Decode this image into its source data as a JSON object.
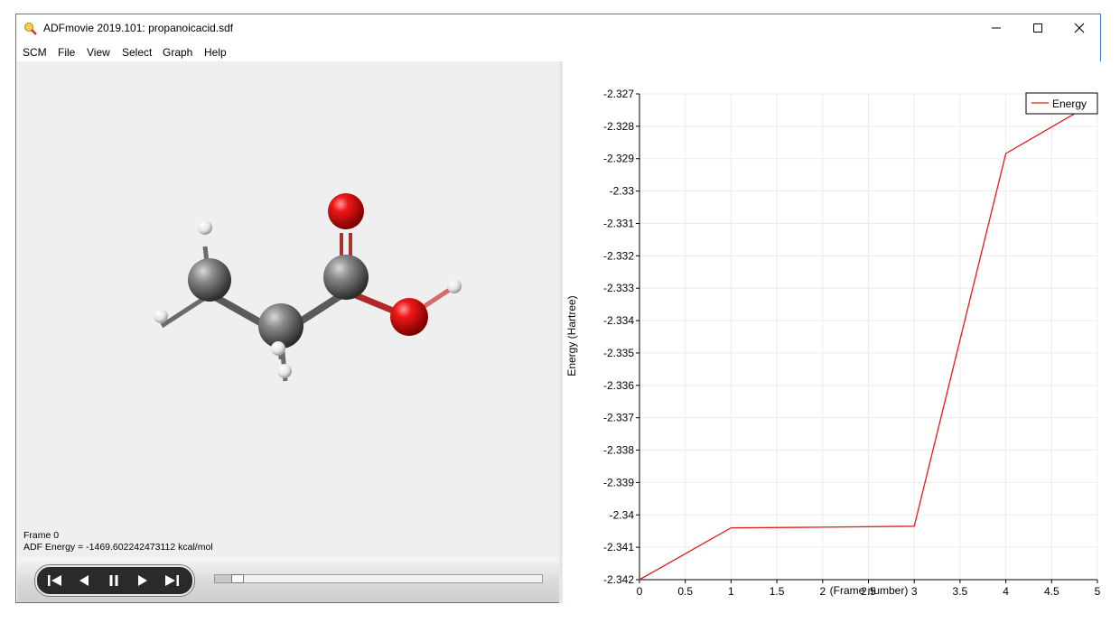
{
  "window": {
    "title": "ADFmovie 2019.101: propanoicacid.sdf"
  },
  "menu": [
    "SCM",
    "File",
    "View",
    "Select",
    "Graph",
    "Help"
  ],
  "status": {
    "frame": "Frame 0",
    "energy": "ADF Energy = -1469.602242473112 kcal/mol"
  },
  "playback": {
    "buttons": [
      "first-frame",
      "previous-frame",
      "pause",
      "next-frame",
      "last-frame"
    ],
    "position_fraction": 0.05
  },
  "chart_data": {
    "type": "line",
    "xlabel": "(Frame number)",
    "ylabel": "Energy (Hartree)",
    "xlim": [
      0,
      5
    ],
    "ylim": [
      -2.342,
      -2.327
    ],
    "x_ticks": [
      "0",
      "0.5",
      "1",
      "1.5",
      "2",
      "2.5",
      "3",
      "3.5",
      "4",
      "4.5",
      "5"
    ],
    "y_ticks": [
      "-2.327",
      "-2.328",
      "-2.329",
      "-2.33",
      "-2.331",
      "-2.332",
      "-2.333",
      "-2.334",
      "-2.335",
      "-2.336",
      "-2.337",
      "-2.338",
      "-2.339",
      "-2.34",
      "-2.341",
      "-2.342"
    ],
    "grid": true,
    "legend": "top-right",
    "series": [
      {
        "name": "Energy",
        "color": "#e31a1c",
        "x": [
          0,
          1,
          2,
          3,
          4,
          5
        ],
        "y": [
          -2.342,
          -2.3404,
          -2.34038,
          -2.34035,
          -2.32884,
          -2.3272
        ]
      }
    ]
  }
}
